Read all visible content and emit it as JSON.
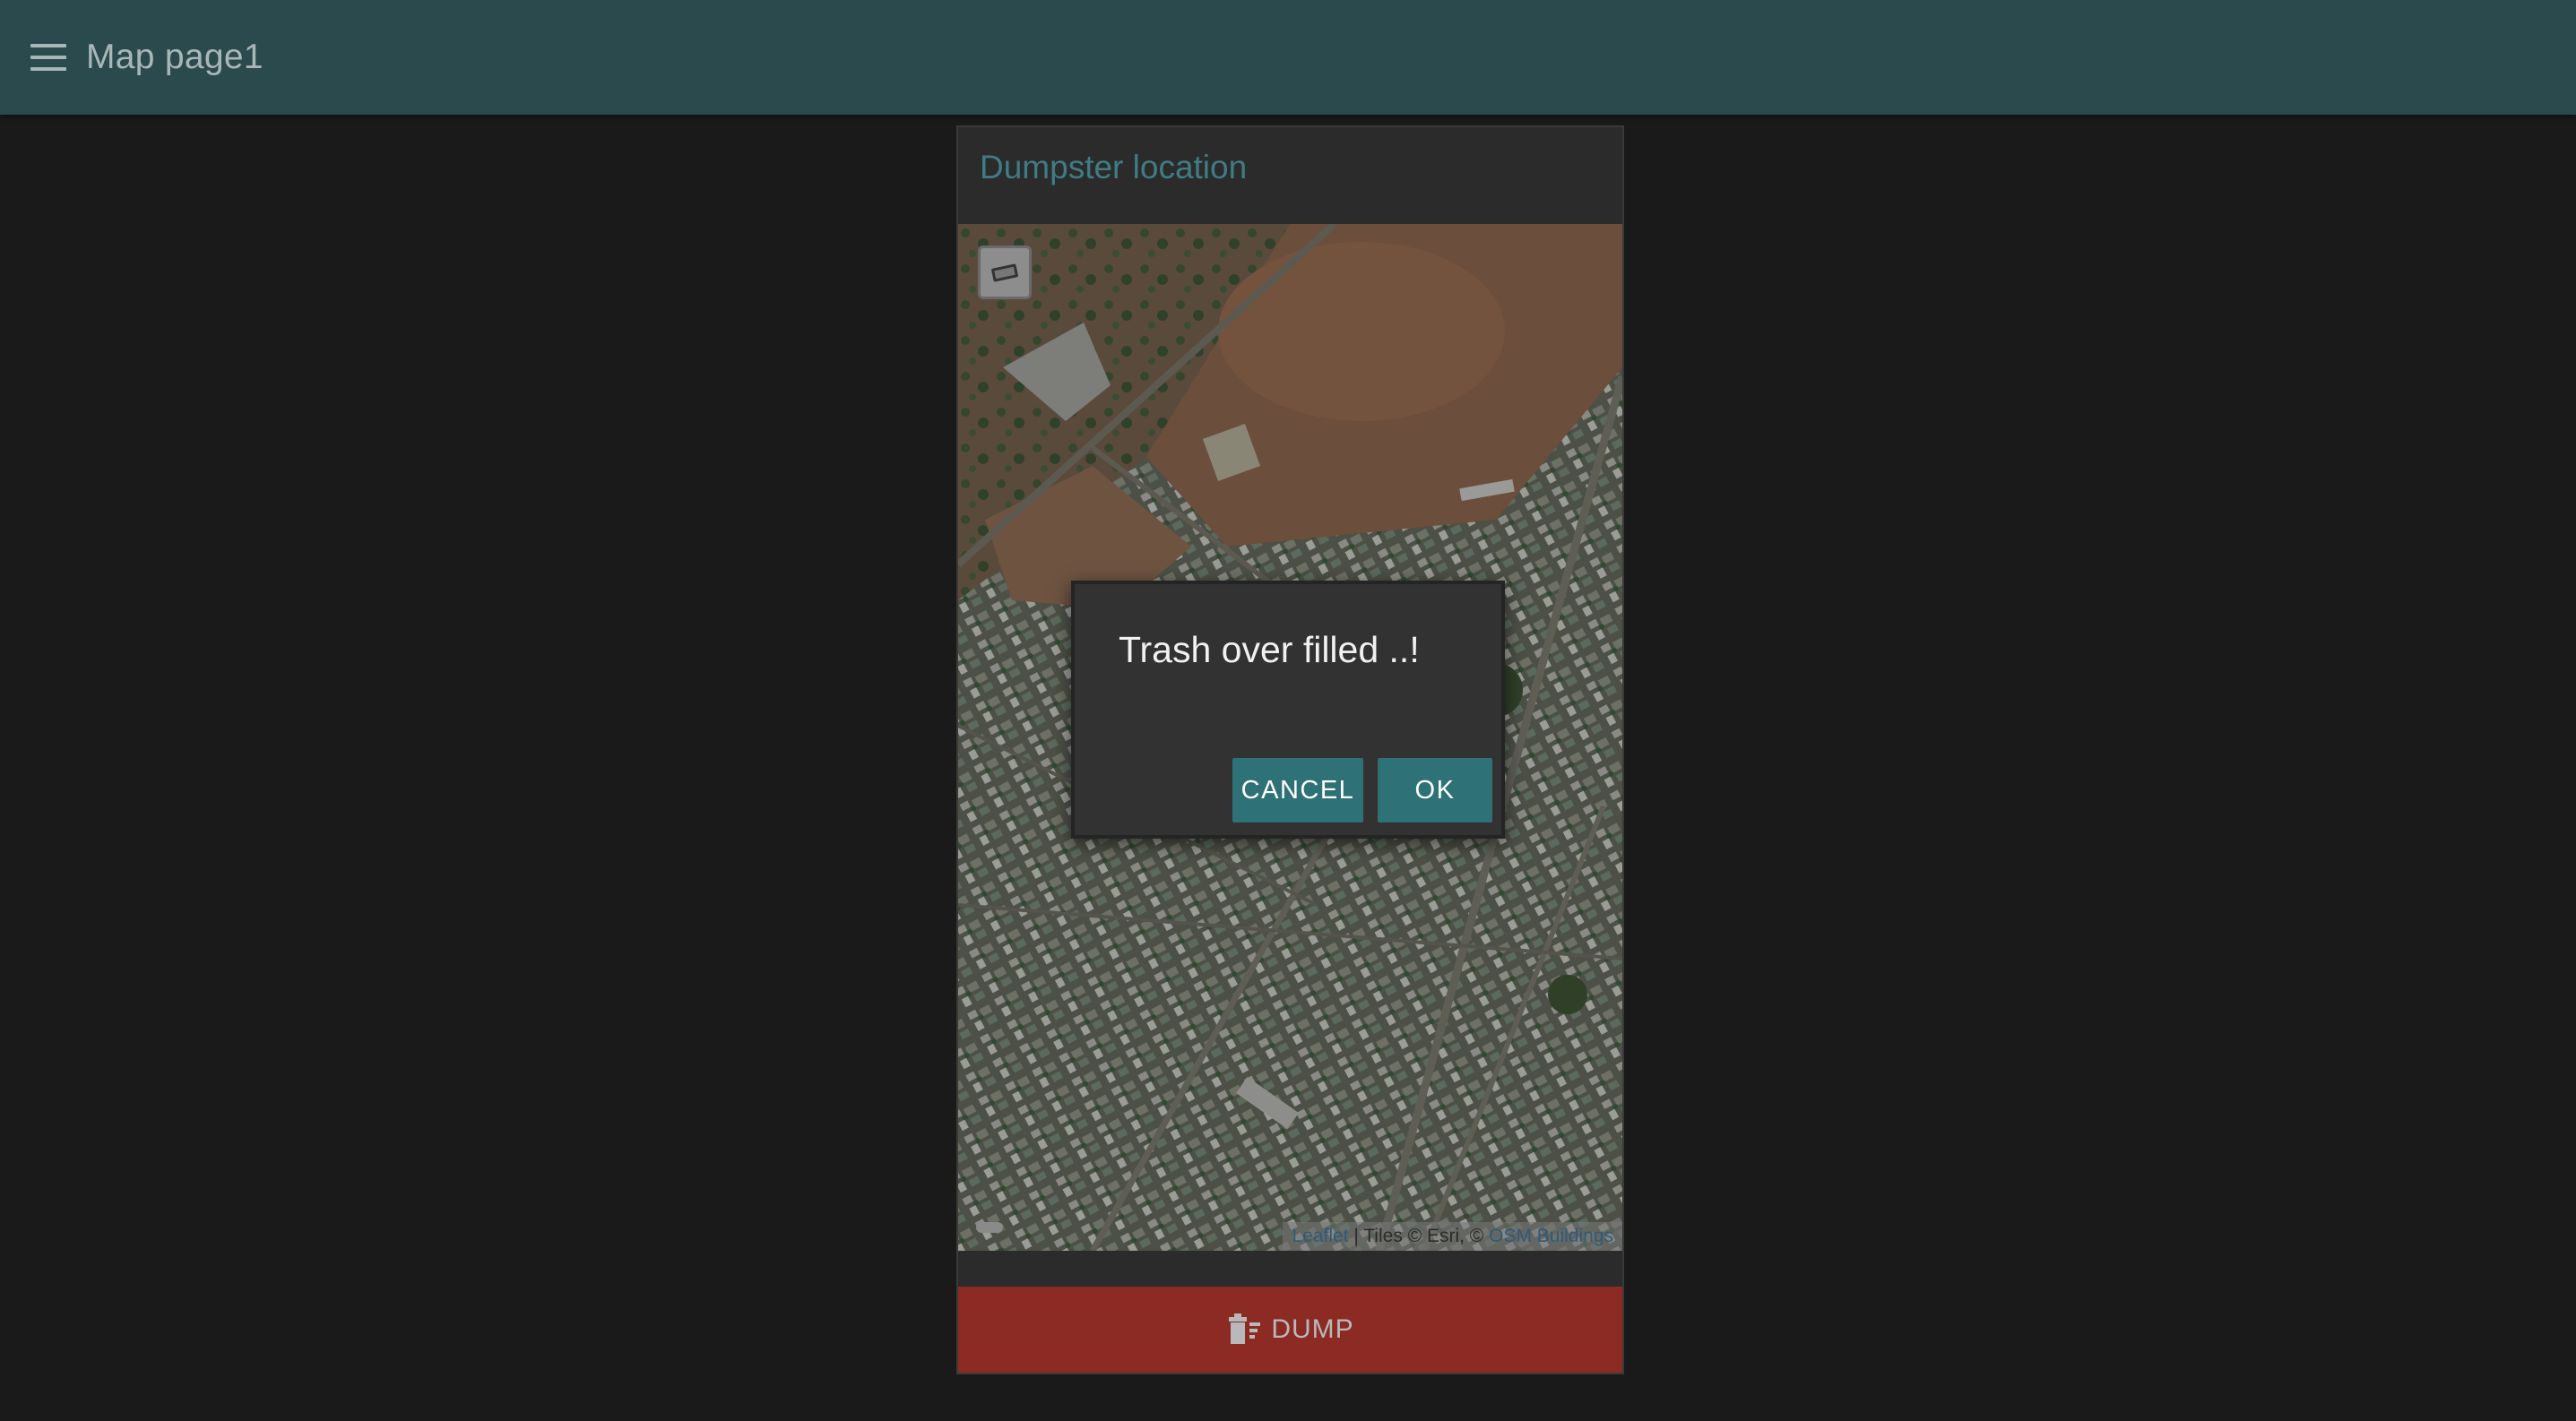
{
  "topbar": {
    "title": "Map page1",
    "menu_icon": "hamburger-menu-icon"
  },
  "card": {
    "title": "Dumpster location",
    "map": {
      "attribution_leaflet": "Leaflet",
      "attribution_tiles": " | Tiles © Esri, © ",
      "attribution_osm": "OSM Buildings",
      "layer_icon": "layers-icon"
    },
    "dump_button": {
      "label": "DUMP",
      "icon": "trash-icon",
      "color": "#8c2a24"
    }
  },
  "dialog": {
    "message": "Trash over filled ..!",
    "cancel_label": "CANCEL",
    "ok_label": "OK",
    "button_color": "#2e7177"
  },
  "colors": {
    "topbar": "#2a4a4d",
    "background": "#1a1a1a",
    "accent_title": "#3f7c84"
  }
}
